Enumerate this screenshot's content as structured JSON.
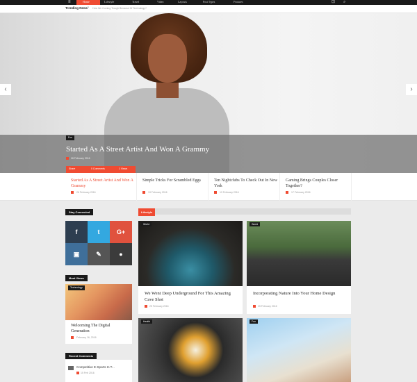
{
  "top_nav": {
    "active_label": "Home",
    "items": [
      "Lifestyle",
      "Travel",
      "Video",
      "Layouts",
      "Post Types",
      "Features"
    ]
  },
  "trending": {
    "label": "Trending News",
    "text": "How We Coming Trough Because Of Technology?"
  },
  "hero": {
    "tag": "Fun",
    "title": "Started As A Street Artist And Won A Grammy",
    "date": "26 February 2016",
    "meta": {
      "share": "Share",
      "comments": "0 Comments",
      "views": "1 Views"
    },
    "colors": {
      "accent": "#ef4b32",
      "overlay": "#6e6e6e"
    }
  },
  "slider_tabs": [
    {
      "title": "Started As A Street Artist And Won A Grammy",
      "date": "26 February 2016",
      "active": true
    },
    {
      "title": "Simple Tricks For Scrambled Eggs",
      "date": "19 February 2016",
      "active": false
    },
    {
      "title": "Ten Nightclubs To Check Out In New York",
      "date": "19 February 2016",
      "active": false
    },
    {
      "title": "Gaming Brings Couples Closer Together?",
      "date": "17 February 2016",
      "active": false
    }
  ],
  "sidebar": {
    "stay_connected": "Stay Connected",
    "social": [
      {
        "icon": "facebook-icon",
        "glyph": "f",
        "color": "#2d3e50"
      },
      {
        "icon": "twitter-icon",
        "glyph": "t",
        "color": "#33a8e0"
      },
      {
        "icon": "google-plus-icon",
        "glyph": "G+",
        "color": "#e0523e"
      },
      {
        "icon": "instagram-icon",
        "glyph": "▣",
        "color": "#3f6f9a"
      },
      {
        "icon": "blog-icon",
        "glyph": "✎",
        "color": "#555555"
      },
      {
        "icon": "chat-icon",
        "glyph": "●",
        "color": "#3b3b3b"
      }
    ],
    "most_views": {
      "title": "Most Views",
      "tag": "Technology",
      "post_title": "Welcoming The Digital Generation",
      "date": "February 16, 2016"
    },
    "recent_comments": {
      "title": "Recent Comments",
      "post": "Competitive E-Sports In T...",
      "date": "15 Feb 2016"
    }
  },
  "lifestyle": {
    "title": "Lifestyle",
    "cards": [
      {
        "tag": "World",
        "title": "We Went Deep Underground For This Amazing Cave Shot",
        "date": "25 February 2016"
      },
      {
        "tag": "World",
        "title": "Incorporating Nature Into Your Home Design",
        "date": "25 February 2016"
      },
      {
        "tag": "Health",
        "title": "",
        "date": ""
      },
      {
        "tag": "Fun",
        "title": "",
        "date": ""
      }
    ]
  }
}
